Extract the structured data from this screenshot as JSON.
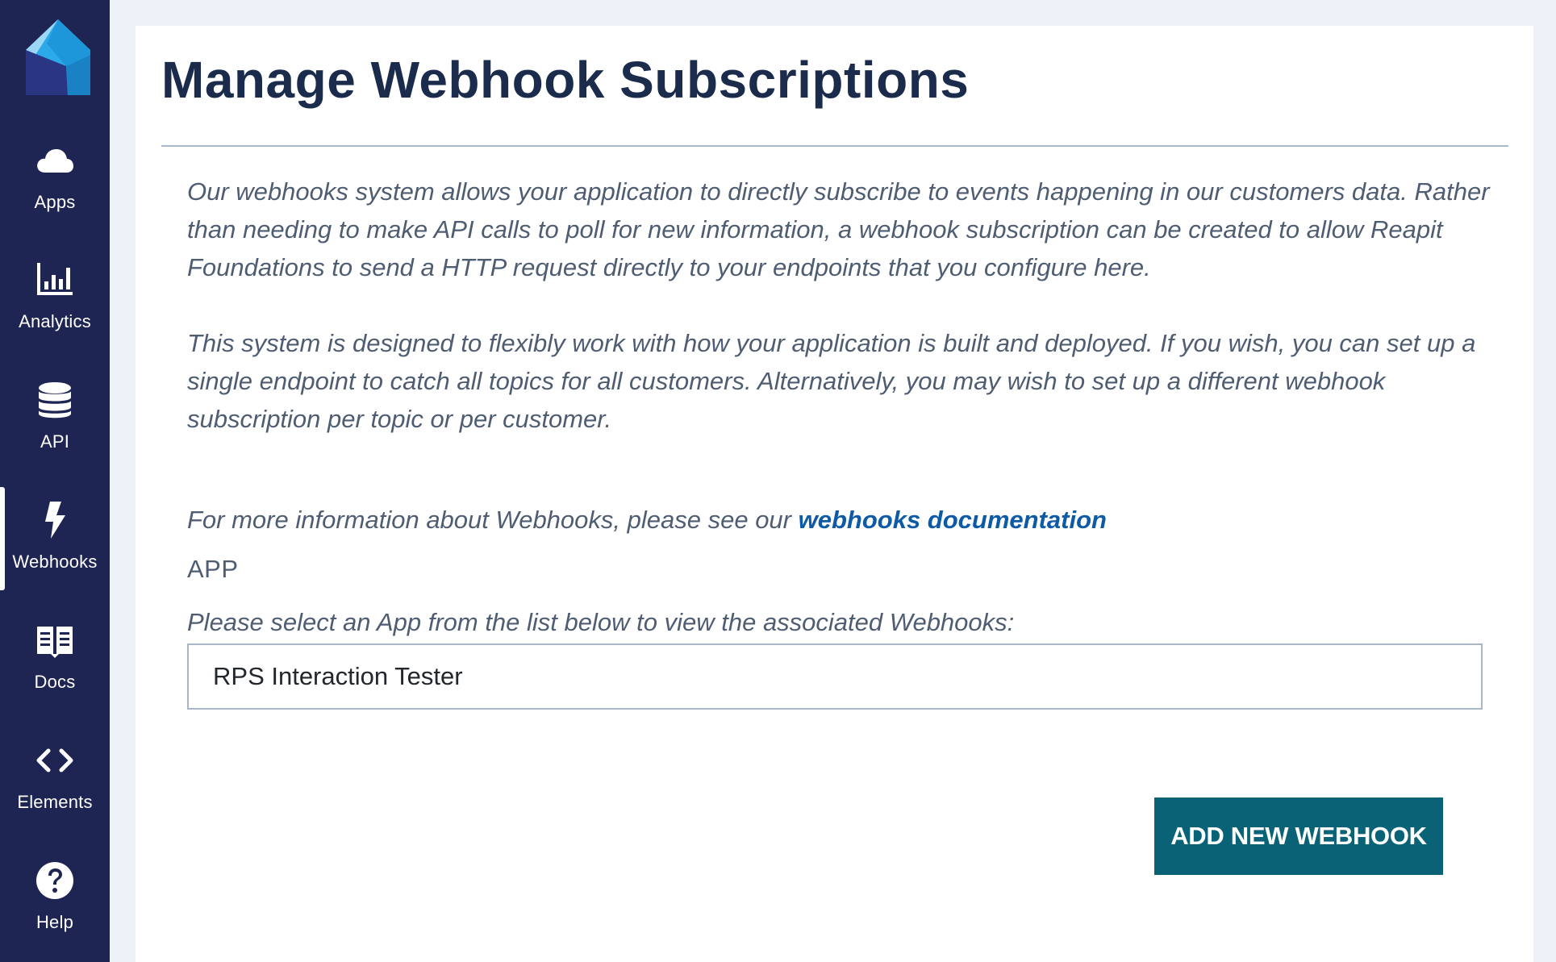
{
  "sidebar": {
    "items": [
      {
        "label": "Apps",
        "icon": "cloud-icon"
      },
      {
        "label": "Analytics",
        "icon": "bar-chart-icon"
      },
      {
        "label": "API",
        "icon": "database-icon"
      },
      {
        "label": "Webhooks",
        "icon": "lightning-bolt-icon",
        "active": true
      },
      {
        "label": "Docs",
        "icon": "book-icon"
      },
      {
        "label": "Elements",
        "icon": "code-brackets-icon"
      },
      {
        "label": "Help",
        "icon": "question-circle-icon"
      }
    ]
  },
  "main": {
    "title": "Manage Webhook Subscriptions",
    "intro_paragraph_1": "Our webhooks system allows your application to directly subscribe to events happening in our customers data. Rather than needing to make API calls to poll for new information, a webhook subscription can be created to allow Reapit Foundations to send a HTTP request directly to your endpoints that you configure here.",
    "intro_paragraph_2": "This system is designed to flexibly work with how your application is built and deployed. If you wish, you can set up a single endpoint to catch all topics for all customers. Alternatively, you may wish to set up a different webhook subscription per topic or per customer.",
    "more_info_prefix": "For more information about Webhooks, please see our ",
    "docs_link_text": "webhooks documentation",
    "app_section_label": "APP",
    "select_hint": "Please select an App from the list below to view the associated Webhooks:",
    "selected_app": "RPS Interaction Tester",
    "add_button_label": "ADD NEW WEBHOOK"
  },
  "colors": {
    "sidebar_bg": "#1f2552",
    "page_bg": "#edf2f9",
    "title": "#1b2b4b",
    "body_text": "#4f5d73",
    "link": "#0d5ba7",
    "button_bg": "#0a6277"
  }
}
